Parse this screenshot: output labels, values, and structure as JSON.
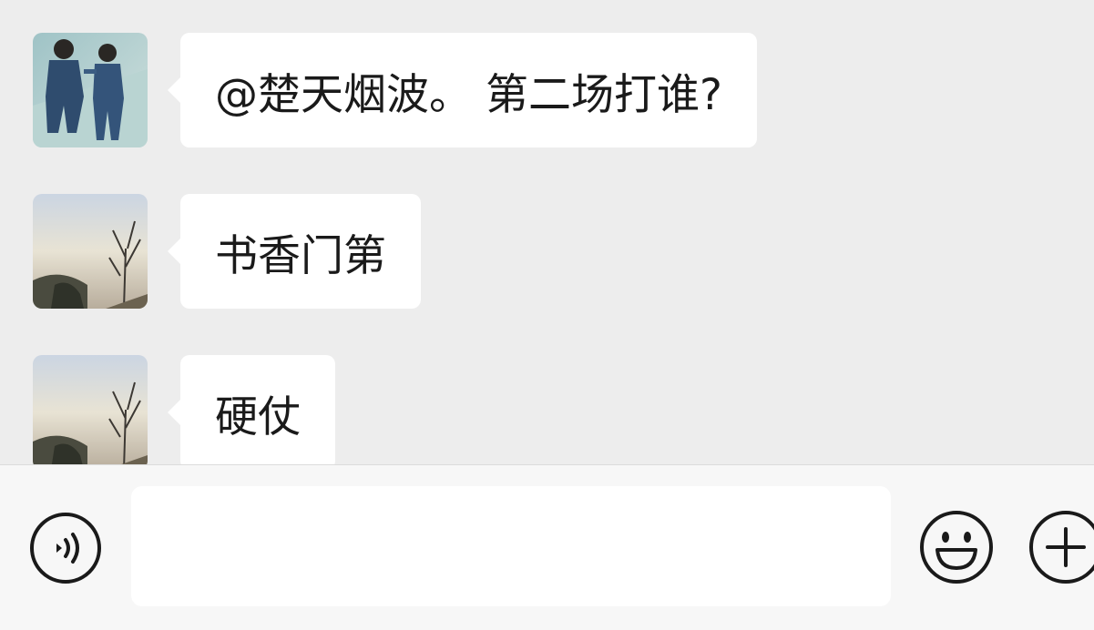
{
  "messages": [
    {
      "sender_avatar": "child-photo-avatar",
      "text": "@楚天烟波。 第二场打谁?"
    },
    {
      "sender_avatar": "landscape-photo-avatar",
      "text": "书香门第"
    },
    {
      "sender_avatar": "landscape-photo-avatar",
      "text": "硬仗"
    }
  ],
  "input_bar": {
    "voice_icon": "voice-icon",
    "input_value": "",
    "emoji_icon": "emoji-icon",
    "plus_icon": "plus-icon"
  },
  "colors": {
    "background": "#ededed",
    "bubble": "#ffffff",
    "input_bar": "#f7f7f7",
    "icon_stroke": "#1a1a1a"
  }
}
